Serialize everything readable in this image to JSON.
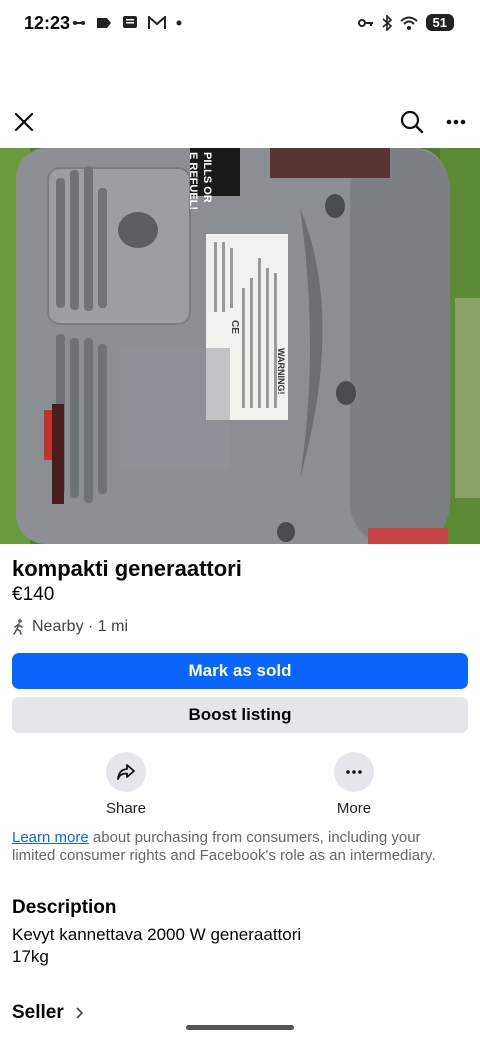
{
  "status_bar": {
    "time": "12:23",
    "battery": "51"
  },
  "listing": {
    "title": "kompakti generaattori",
    "price": "€140",
    "location": "Nearby · 1 mi"
  },
  "buttons": {
    "mark_sold": "Mark as sold",
    "boost": "Boost listing"
  },
  "actions": {
    "share": "Share",
    "more": "More"
  },
  "info": {
    "link": "Learn more",
    "text": " about purchasing from consumers, including your limited consumer rights and Facebook's role as an intermediary."
  },
  "description": {
    "heading": "Description",
    "line1": "Kevyt kannettava 2000 W generaattori",
    "line2": "17kg"
  },
  "seller": {
    "heading": "Seller"
  },
  "photo": {
    "sticker_text": "PILLS OR\nE REFUEL!",
    "label_title": "WARNING!",
    "label_mark": "CE"
  },
  "colors": {
    "accent": "#0866ff",
    "secondary_button": "#e4e6eb"
  }
}
